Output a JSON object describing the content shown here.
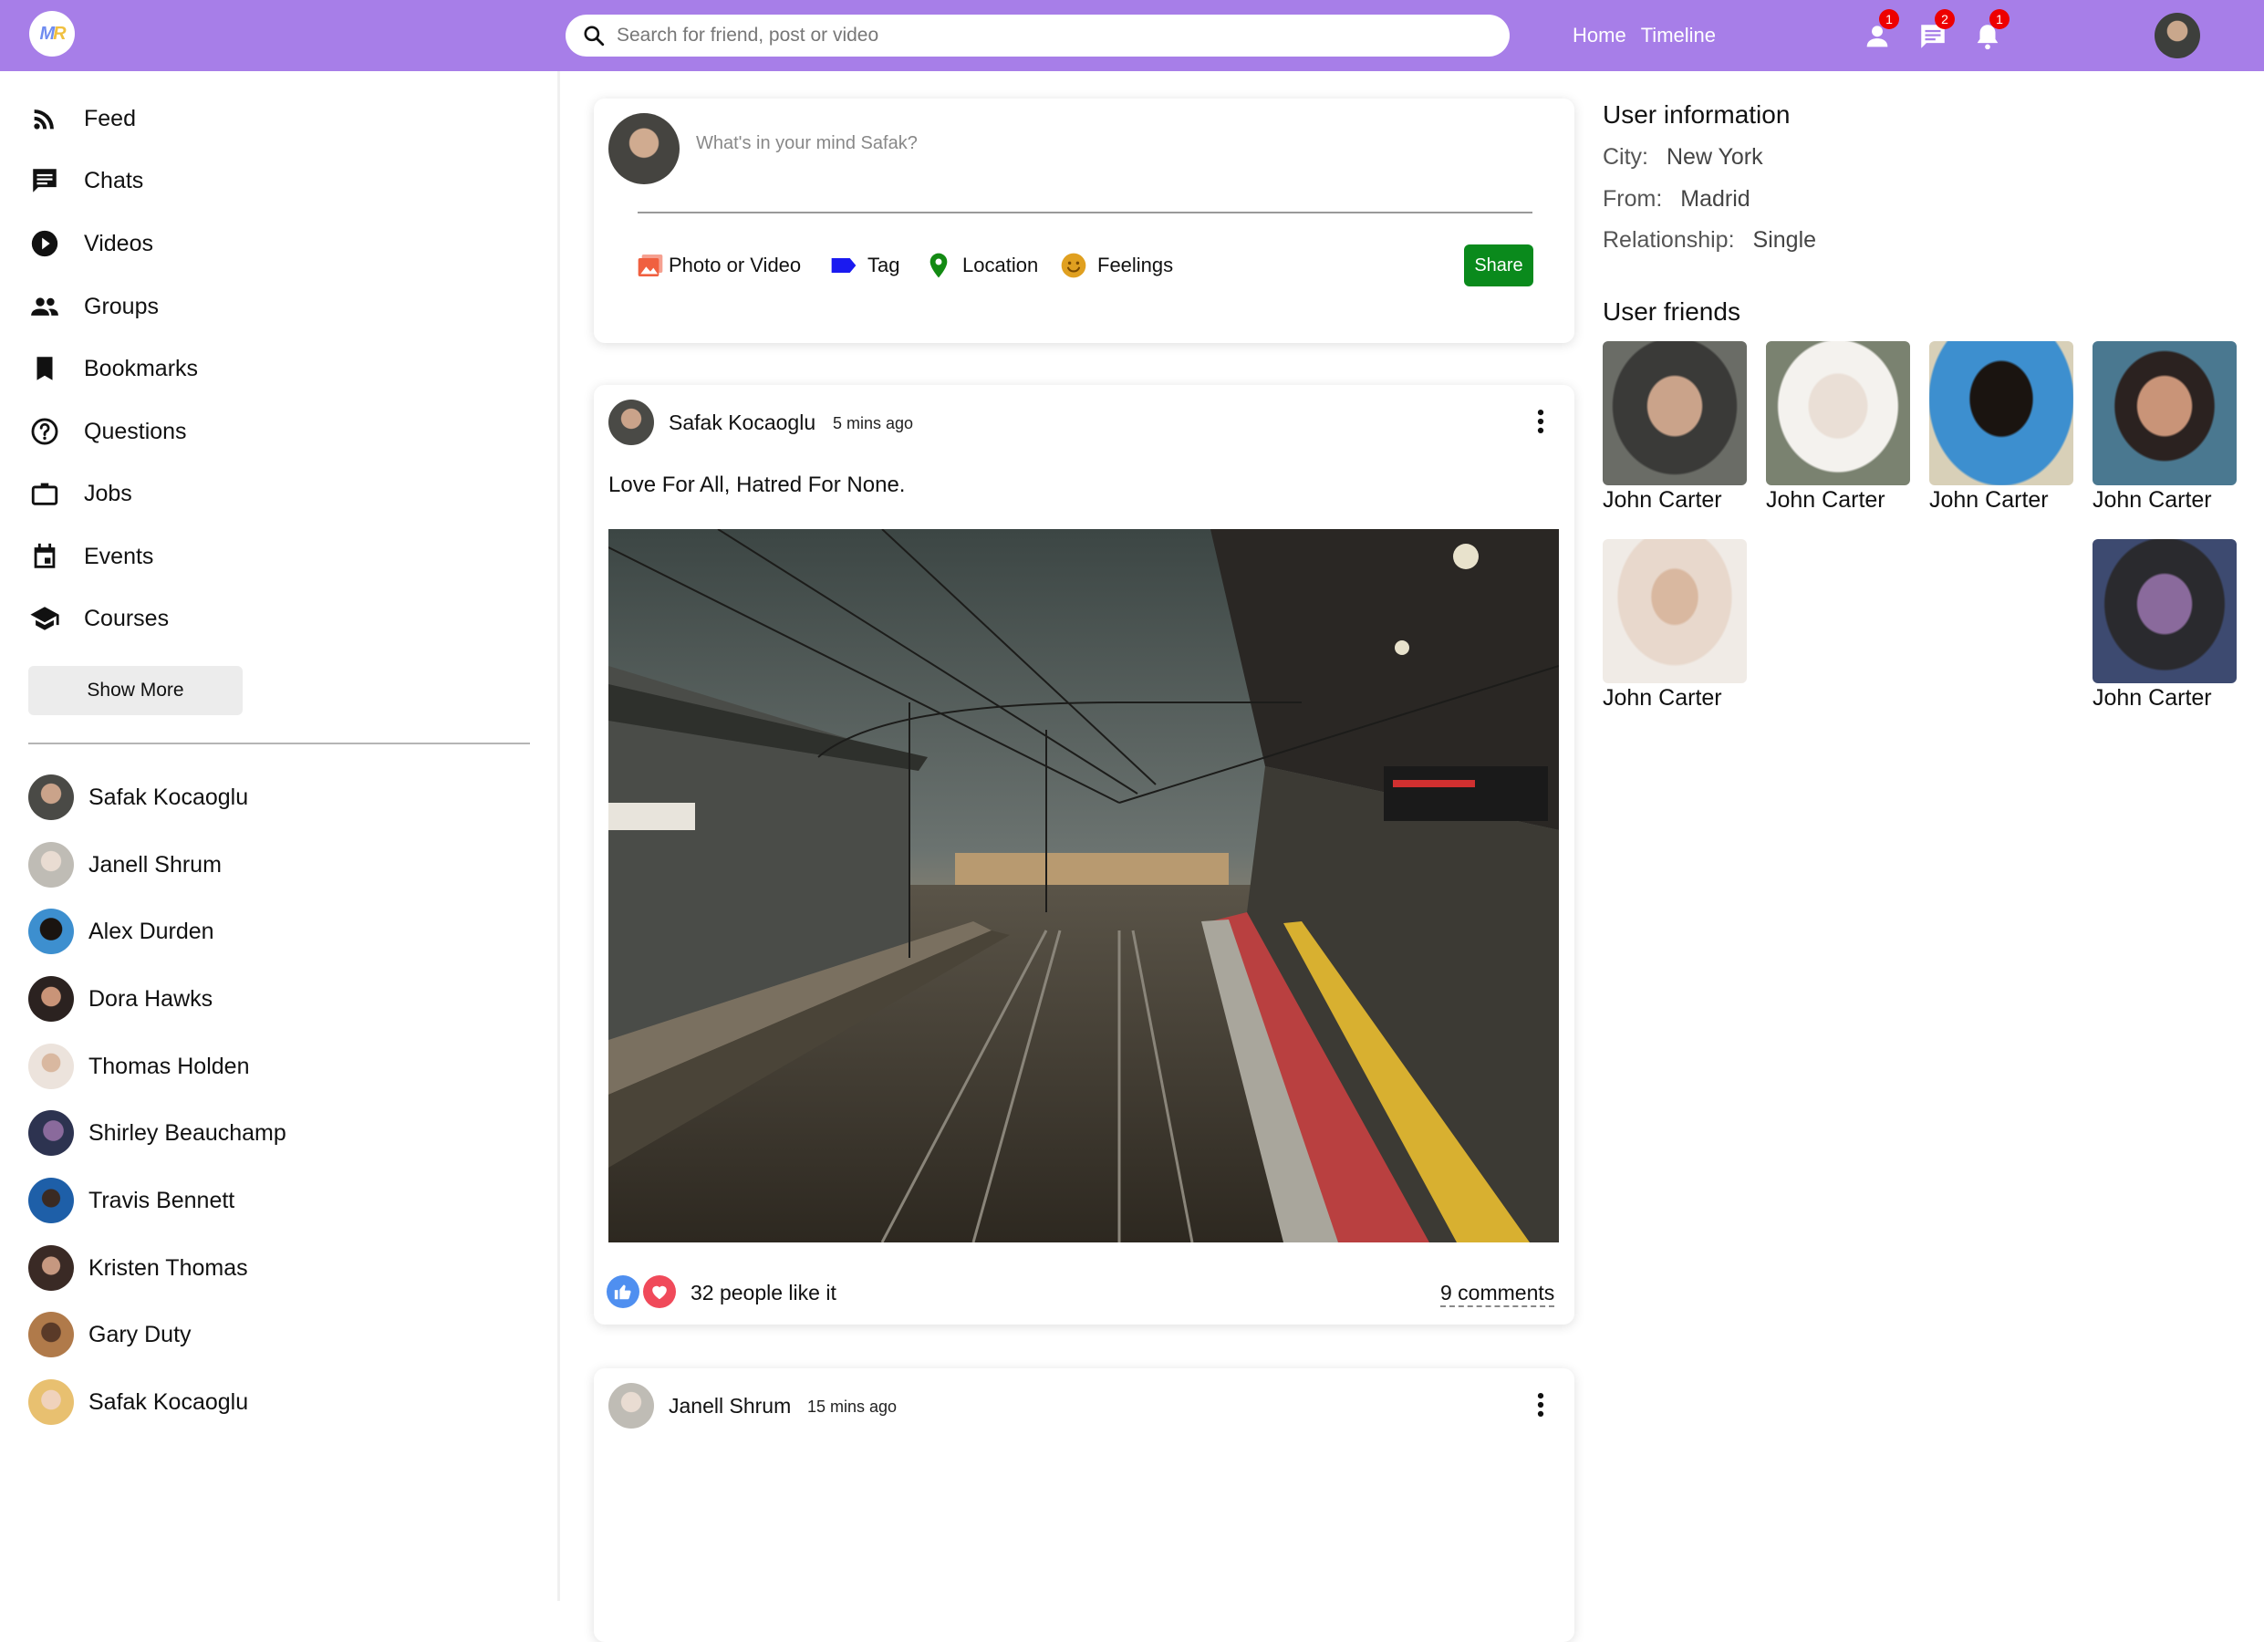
{
  "header": {
    "logo_text": "MR",
    "search_placeholder": "Search for friend, post or video",
    "links": [
      "Home",
      "Timeline"
    ],
    "badges": {
      "friends": "1",
      "messages": "2",
      "notifications": "1"
    }
  },
  "sidebar": {
    "nav": [
      {
        "label": "Feed",
        "icon": "rss-icon"
      },
      {
        "label": "Chats",
        "icon": "chat-icon"
      },
      {
        "label": "Videos",
        "icon": "play-circle-icon"
      },
      {
        "label": "Groups",
        "icon": "group-icon"
      },
      {
        "label": "Bookmarks",
        "icon": "bookmark-icon"
      },
      {
        "label": "Questions",
        "icon": "help-circle-icon"
      },
      {
        "label": "Jobs",
        "icon": "briefcase-icon"
      },
      {
        "label": "Events",
        "icon": "calendar-icon"
      },
      {
        "label": "Courses",
        "icon": "school-icon"
      }
    ],
    "show_more": "Show More",
    "friends": [
      "Safak Kocaoglu",
      "Janell Shrum",
      "Alex Durden",
      "Dora Hawks",
      "Thomas Holden",
      "Shirley Beauchamp",
      "Travis Bennett",
      "Kristen Thomas",
      "Gary Duty",
      "Safak Kocaoglu"
    ]
  },
  "share": {
    "placeholder": "What's in your mind Safak?",
    "options": [
      "Photo or Video",
      "Tag",
      "Location",
      "Feelings"
    ],
    "button": "Share"
  },
  "posts": [
    {
      "author": "Safak Kocaoglu",
      "time": "5 mins ago",
      "text": "Love For All, Hatred For None.",
      "likes": "32 people like it",
      "comments": "9 comments"
    },
    {
      "author": "Janell Shrum",
      "time": "15 mins ago"
    }
  ],
  "right": {
    "info_title": "User information",
    "info": [
      {
        "key": "City:",
        "value": "New York"
      },
      {
        "key": "From:",
        "value": "Madrid"
      },
      {
        "key": "Relationship:",
        "value": "Single"
      }
    ],
    "friends_title": "User friends",
    "friends": [
      "John Carter",
      "John Carter",
      "John Carter",
      "John Carter",
      "John Carter",
      "John Carter"
    ]
  },
  "colors": {
    "topbar": "#a77ee8",
    "share_button": "#0a8a1c",
    "photo_icon": "#f06040",
    "tag_icon": "#1a1af0",
    "location_icon": "#138a13",
    "feelings_icon": "#e0a020",
    "like": "#4f8ff0",
    "love": "#f04a5a",
    "badge": "#ee0000"
  }
}
